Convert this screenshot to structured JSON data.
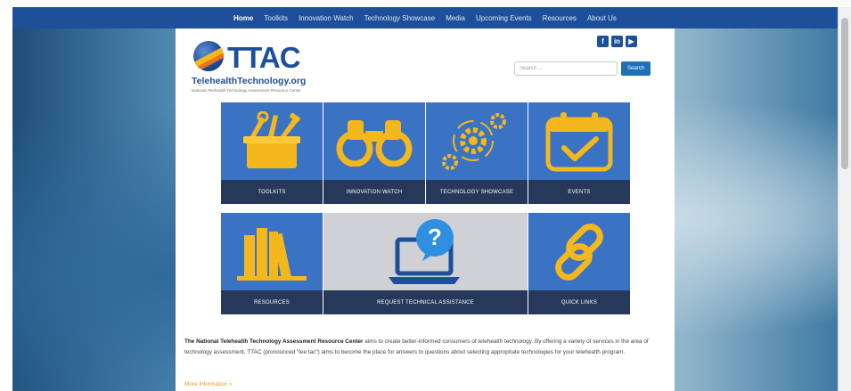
{
  "nav": {
    "items": [
      {
        "label": "Home"
      },
      {
        "label": "Toolkits"
      },
      {
        "label": "Innovation Watch"
      },
      {
        "label": "Technology Showcase"
      },
      {
        "label": "Media"
      },
      {
        "label": "Upcoming Events"
      },
      {
        "label": "Resources"
      },
      {
        "label": "About Us"
      }
    ],
    "active": "Home"
  },
  "logo": {
    "title": "TTAC",
    "subtitle": "TelehealthTechnology.org",
    "tagline": "National Telehealth Technology Assessment Resource Center"
  },
  "social": {
    "icons": [
      "facebook-icon",
      "linkedin-icon",
      "youtube-icon"
    ],
    "glyphs": [
      "f",
      "in",
      "▶"
    ]
  },
  "search": {
    "placeholder": "Search ...",
    "button_label": "Search"
  },
  "tiles": [
    {
      "label": "TOOLKITS",
      "icon": "toolbox-icon"
    },
    {
      "label": "INNOVATION WATCH",
      "icon": "binoculars-icon"
    },
    {
      "label": "TECHNOLOGY SHOWCASE",
      "icon": "gears-icon"
    },
    {
      "label": "EVENTS",
      "icon": "calendar-icon"
    },
    {
      "label": "RESOURCES",
      "icon": "books-icon"
    },
    {
      "label": "REQUEST TECHNICAL ASSISTANCE",
      "icon": "laptop-question-icon"
    },
    {
      "label": "QUICK LINKS",
      "icon": "chain-link-icon"
    }
  ],
  "about": {
    "org_name": "The National Telehealth Technology Assessment Resource Center",
    "text": " aims to create better-informed consumers of telehealth technology. By offering a variety of services in the area of technology assessment, TTAC (pronounced \"tee tac\") aims to become the place for answers to questions about selecting appropriate technologies for your telehealth program.",
    "more_link": "More Information »"
  },
  "colors": {
    "nav_bg": "#1d4f9a",
    "tile_blue": "#3a73c4",
    "tile_label_bg": "#27395a",
    "icon_yellow": "#f5b81c",
    "link_orange": "#e8a020"
  }
}
